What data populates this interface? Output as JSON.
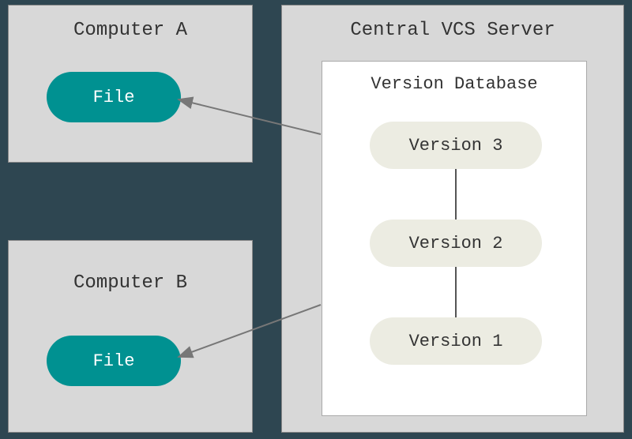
{
  "computerA": {
    "title": "Computer A",
    "file_label": "File"
  },
  "computerB": {
    "title": "Computer B",
    "file_label": "File"
  },
  "server": {
    "title": "Central VCS Server",
    "db_title": "Version Database",
    "versions": {
      "v3": "Version 3",
      "v2": "Version 2",
      "v1": "Version 1"
    }
  },
  "colors": {
    "teal": "#009191",
    "bg": "#2e4651",
    "box": "#d8d8d8",
    "pill_grey": "#ecece2"
  }
}
